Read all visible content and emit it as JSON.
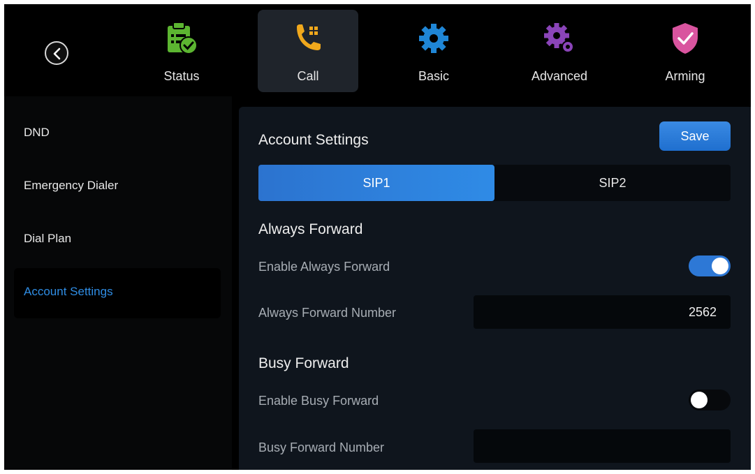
{
  "nav": {
    "items": [
      {
        "label": "Status",
        "icon": "status-clipboard-check-icon",
        "color": "#5cb531"
      },
      {
        "label": "Call",
        "icon": "call-phone-keypad-icon",
        "color": "#f0a81c"
      },
      {
        "label": "Basic",
        "icon": "basic-gear-icon",
        "color": "#1f86d6"
      },
      {
        "label": "Advanced",
        "icon": "advanced-gears-icon",
        "color": "#8a44b8"
      },
      {
        "label": "Arming",
        "icon": "arming-shield-icon",
        "color": "#d9549f"
      }
    ],
    "active": "Call"
  },
  "sidebar": {
    "items": [
      {
        "label": "DND"
      },
      {
        "label": "Emergency Dialer"
      },
      {
        "label": "Dial Plan"
      },
      {
        "label": "Account Settings"
      }
    ],
    "active": "Account Settings"
  },
  "main": {
    "title": "Account Settings",
    "save_label": "Save",
    "tabs": [
      {
        "label": "SIP1"
      },
      {
        "label": "SIP2"
      }
    ],
    "active_tab": "SIP1",
    "always_forward": {
      "title": "Always Forward",
      "enable_label": "Enable Always Forward",
      "enabled": true,
      "number_label": "Always Forward Number",
      "number_value": "2562"
    },
    "busy_forward": {
      "title": "Busy Forward",
      "enable_label": "Enable Busy Forward",
      "enabled": false,
      "number_label": "Busy Forward Number",
      "number_value": ""
    }
  },
  "colors": {
    "accent": "#2f8be6",
    "active_menu_text": "#2f8de4",
    "panel_bg": "#0f151d"
  }
}
